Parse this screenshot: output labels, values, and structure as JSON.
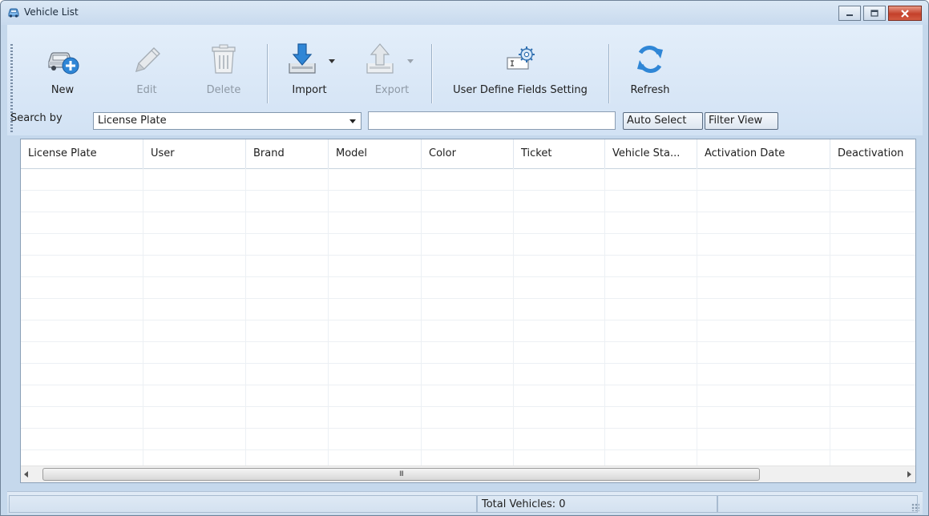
{
  "window": {
    "title": "Vehicle List",
    "icon": "car-icon"
  },
  "toolbar": {
    "new_label": "New",
    "edit_label": "Edit",
    "delete_label": "Delete",
    "import_label": "Import",
    "export_label": "Export",
    "udf_label": "User Define Fields Setting",
    "refresh_label": "Refresh"
  },
  "search": {
    "label": "Search by",
    "field_value": "License Plate",
    "input_value": "",
    "auto_select_label": "Auto Select",
    "filter_view_label": "Filter View"
  },
  "table": {
    "columns": [
      "License Plate",
      "User",
      "Brand",
      "Model",
      "Color",
      "Ticket",
      "Vehicle Sta...",
      "Activation Date",
      "Deactivation"
    ],
    "rows": []
  },
  "scrollbar": {
    "grip": "III"
  },
  "status": {
    "total_text": "Total Vehicles: 0"
  },
  "colors": {
    "accent": "#2f86d6",
    "close": "#c4402a"
  }
}
